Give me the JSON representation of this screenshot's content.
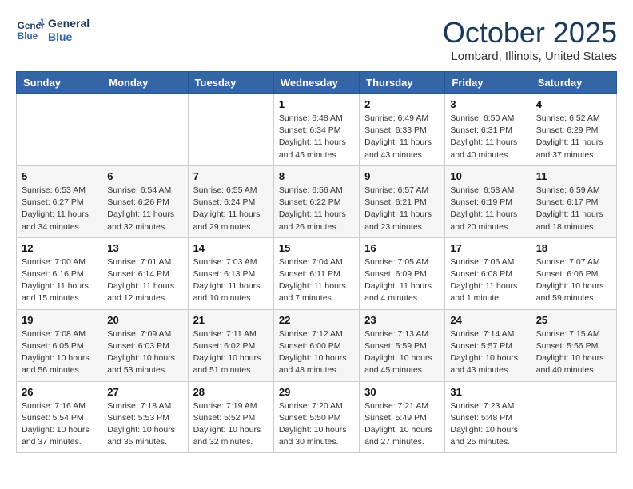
{
  "logo": {
    "line1": "General",
    "line2": "Blue"
  },
  "title": "October 2025",
  "location": "Lombard, Illinois, United States",
  "days_of_week": [
    "Sunday",
    "Monday",
    "Tuesday",
    "Wednesday",
    "Thursday",
    "Friday",
    "Saturday"
  ],
  "weeks": [
    [
      {
        "day": "",
        "info": ""
      },
      {
        "day": "",
        "info": ""
      },
      {
        "day": "",
        "info": ""
      },
      {
        "day": "1",
        "info": "Sunrise: 6:48 AM\nSunset: 6:34 PM\nDaylight: 11 hours and 45 minutes."
      },
      {
        "day": "2",
        "info": "Sunrise: 6:49 AM\nSunset: 6:33 PM\nDaylight: 11 hours and 43 minutes."
      },
      {
        "day": "3",
        "info": "Sunrise: 6:50 AM\nSunset: 6:31 PM\nDaylight: 11 hours and 40 minutes."
      },
      {
        "day": "4",
        "info": "Sunrise: 6:52 AM\nSunset: 6:29 PM\nDaylight: 11 hours and 37 minutes."
      }
    ],
    [
      {
        "day": "5",
        "info": "Sunrise: 6:53 AM\nSunset: 6:27 PM\nDaylight: 11 hours and 34 minutes."
      },
      {
        "day": "6",
        "info": "Sunrise: 6:54 AM\nSunset: 6:26 PM\nDaylight: 11 hours and 32 minutes."
      },
      {
        "day": "7",
        "info": "Sunrise: 6:55 AM\nSunset: 6:24 PM\nDaylight: 11 hours and 29 minutes."
      },
      {
        "day": "8",
        "info": "Sunrise: 6:56 AM\nSunset: 6:22 PM\nDaylight: 11 hours and 26 minutes."
      },
      {
        "day": "9",
        "info": "Sunrise: 6:57 AM\nSunset: 6:21 PM\nDaylight: 11 hours and 23 minutes."
      },
      {
        "day": "10",
        "info": "Sunrise: 6:58 AM\nSunset: 6:19 PM\nDaylight: 11 hours and 20 minutes."
      },
      {
        "day": "11",
        "info": "Sunrise: 6:59 AM\nSunset: 6:17 PM\nDaylight: 11 hours and 18 minutes."
      }
    ],
    [
      {
        "day": "12",
        "info": "Sunrise: 7:00 AM\nSunset: 6:16 PM\nDaylight: 11 hours and 15 minutes."
      },
      {
        "day": "13",
        "info": "Sunrise: 7:01 AM\nSunset: 6:14 PM\nDaylight: 11 hours and 12 minutes."
      },
      {
        "day": "14",
        "info": "Sunrise: 7:03 AM\nSunset: 6:13 PM\nDaylight: 11 hours and 10 minutes."
      },
      {
        "day": "15",
        "info": "Sunrise: 7:04 AM\nSunset: 6:11 PM\nDaylight: 11 hours and 7 minutes."
      },
      {
        "day": "16",
        "info": "Sunrise: 7:05 AM\nSunset: 6:09 PM\nDaylight: 11 hours and 4 minutes."
      },
      {
        "day": "17",
        "info": "Sunrise: 7:06 AM\nSunset: 6:08 PM\nDaylight: 11 hours and 1 minute."
      },
      {
        "day": "18",
        "info": "Sunrise: 7:07 AM\nSunset: 6:06 PM\nDaylight: 10 hours and 59 minutes."
      }
    ],
    [
      {
        "day": "19",
        "info": "Sunrise: 7:08 AM\nSunset: 6:05 PM\nDaylight: 10 hours and 56 minutes."
      },
      {
        "day": "20",
        "info": "Sunrise: 7:09 AM\nSunset: 6:03 PM\nDaylight: 10 hours and 53 minutes."
      },
      {
        "day": "21",
        "info": "Sunrise: 7:11 AM\nSunset: 6:02 PM\nDaylight: 10 hours and 51 minutes."
      },
      {
        "day": "22",
        "info": "Sunrise: 7:12 AM\nSunset: 6:00 PM\nDaylight: 10 hours and 48 minutes."
      },
      {
        "day": "23",
        "info": "Sunrise: 7:13 AM\nSunset: 5:59 PM\nDaylight: 10 hours and 45 minutes."
      },
      {
        "day": "24",
        "info": "Sunrise: 7:14 AM\nSunset: 5:57 PM\nDaylight: 10 hours and 43 minutes."
      },
      {
        "day": "25",
        "info": "Sunrise: 7:15 AM\nSunset: 5:56 PM\nDaylight: 10 hours and 40 minutes."
      }
    ],
    [
      {
        "day": "26",
        "info": "Sunrise: 7:16 AM\nSunset: 5:54 PM\nDaylight: 10 hours and 37 minutes."
      },
      {
        "day": "27",
        "info": "Sunrise: 7:18 AM\nSunset: 5:53 PM\nDaylight: 10 hours and 35 minutes."
      },
      {
        "day": "28",
        "info": "Sunrise: 7:19 AM\nSunset: 5:52 PM\nDaylight: 10 hours and 32 minutes."
      },
      {
        "day": "29",
        "info": "Sunrise: 7:20 AM\nSunset: 5:50 PM\nDaylight: 10 hours and 30 minutes."
      },
      {
        "day": "30",
        "info": "Sunrise: 7:21 AM\nSunset: 5:49 PM\nDaylight: 10 hours and 27 minutes."
      },
      {
        "day": "31",
        "info": "Sunrise: 7:23 AM\nSunset: 5:48 PM\nDaylight: 10 hours and 25 minutes."
      },
      {
        "day": "",
        "info": ""
      }
    ]
  ]
}
